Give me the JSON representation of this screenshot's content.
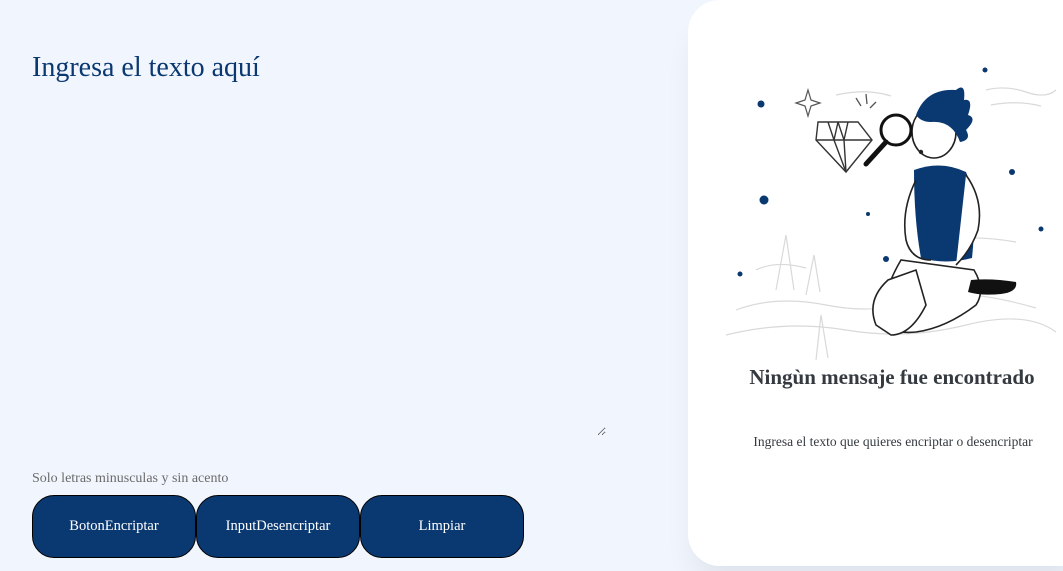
{
  "editor": {
    "placeholder": "Ingresa el texto aquí"
  },
  "hint": "Solo letras minusculas y sin acento",
  "buttons": {
    "encrypt": "BotonEncriptar",
    "decrypt": "InputDesencriptar",
    "clear": "Limpiar"
  },
  "result": {
    "title": "Ningùn mensaje fue encontrado",
    "subtitle": "Ingresa el texto que quieres encriptar o desencriptar"
  },
  "colors": {
    "primary": "#0a3871",
    "background": "#f1f5fd",
    "card": "#ffffff",
    "text_dark": "#343a40"
  },
  "icons": {
    "illustration": "person-with-magnifying-glass-illustration"
  }
}
